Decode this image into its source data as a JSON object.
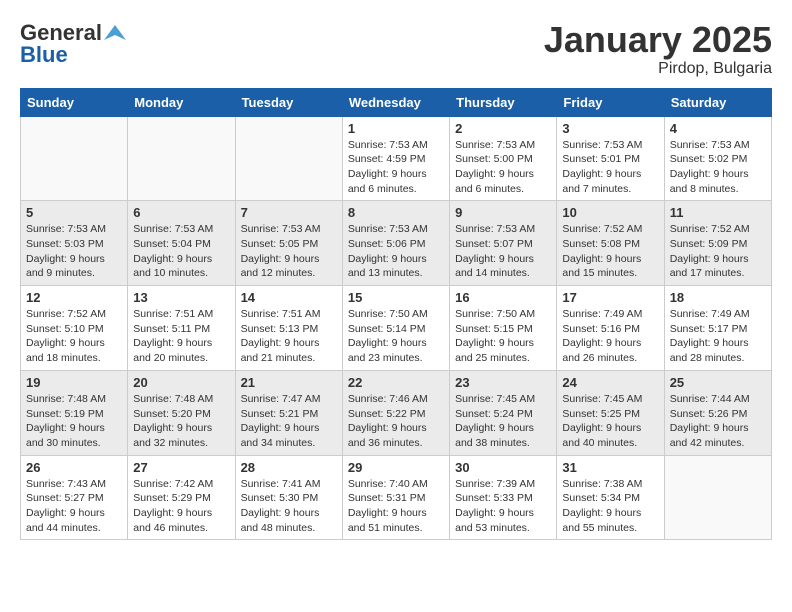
{
  "header": {
    "logo_general": "General",
    "logo_blue": "Blue",
    "title": "January 2025",
    "subtitle": "Pirdop, Bulgaria"
  },
  "days_header": [
    "Sunday",
    "Monday",
    "Tuesday",
    "Wednesday",
    "Thursday",
    "Friday",
    "Saturday"
  ],
  "weeks": [
    {
      "shaded": false,
      "days": [
        {
          "num": "",
          "info": "",
          "empty": true
        },
        {
          "num": "",
          "info": "",
          "empty": true
        },
        {
          "num": "",
          "info": "",
          "empty": true
        },
        {
          "num": "1",
          "info": "Sunrise: 7:53 AM\nSunset: 4:59 PM\nDaylight: 9 hours\nand 6 minutes.",
          "empty": false
        },
        {
          "num": "2",
          "info": "Sunrise: 7:53 AM\nSunset: 5:00 PM\nDaylight: 9 hours\nand 6 minutes.",
          "empty": false
        },
        {
          "num": "3",
          "info": "Sunrise: 7:53 AM\nSunset: 5:01 PM\nDaylight: 9 hours\nand 7 minutes.",
          "empty": false
        },
        {
          "num": "4",
          "info": "Sunrise: 7:53 AM\nSunset: 5:02 PM\nDaylight: 9 hours\nand 8 minutes.",
          "empty": false
        }
      ]
    },
    {
      "shaded": true,
      "days": [
        {
          "num": "5",
          "info": "Sunrise: 7:53 AM\nSunset: 5:03 PM\nDaylight: 9 hours\nand 9 minutes.",
          "empty": false
        },
        {
          "num": "6",
          "info": "Sunrise: 7:53 AM\nSunset: 5:04 PM\nDaylight: 9 hours\nand 10 minutes.",
          "empty": false
        },
        {
          "num": "7",
          "info": "Sunrise: 7:53 AM\nSunset: 5:05 PM\nDaylight: 9 hours\nand 12 minutes.",
          "empty": false
        },
        {
          "num": "8",
          "info": "Sunrise: 7:53 AM\nSunset: 5:06 PM\nDaylight: 9 hours\nand 13 minutes.",
          "empty": false
        },
        {
          "num": "9",
          "info": "Sunrise: 7:53 AM\nSunset: 5:07 PM\nDaylight: 9 hours\nand 14 minutes.",
          "empty": false
        },
        {
          "num": "10",
          "info": "Sunrise: 7:52 AM\nSunset: 5:08 PM\nDaylight: 9 hours\nand 15 minutes.",
          "empty": false
        },
        {
          "num": "11",
          "info": "Sunrise: 7:52 AM\nSunset: 5:09 PM\nDaylight: 9 hours\nand 17 minutes.",
          "empty": false
        }
      ]
    },
    {
      "shaded": false,
      "days": [
        {
          "num": "12",
          "info": "Sunrise: 7:52 AM\nSunset: 5:10 PM\nDaylight: 9 hours\nand 18 minutes.",
          "empty": false
        },
        {
          "num": "13",
          "info": "Sunrise: 7:51 AM\nSunset: 5:11 PM\nDaylight: 9 hours\nand 20 minutes.",
          "empty": false
        },
        {
          "num": "14",
          "info": "Sunrise: 7:51 AM\nSunset: 5:13 PM\nDaylight: 9 hours\nand 21 minutes.",
          "empty": false
        },
        {
          "num": "15",
          "info": "Sunrise: 7:50 AM\nSunset: 5:14 PM\nDaylight: 9 hours\nand 23 minutes.",
          "empty": false
        },
        {
          "num": "16",
          "info": "Sunrise: 7:50 AM\nSunset: 5:15 PM\nDaylight: 9 hours\nand 25 minutes.",
          "empty": false
        },
        {
          "num": "17",
          "info": "Sunrise: 7:49 AM\nSunset: 5:16 PM\nDaylight: 9 hours\nand 26 minutes.",
          "empty": false
        },
        {
          "num": "18",
          "info": "Sunrise: 7:49 AM\nSunset: 5:17 PM\nDaylight: 9 hours\nand 28 minutes.",
          "empty": false
        }
      ]
    },
    {
      "shaded": true,
      "days": [
        {
          "num": "19",
          "info": "Sunrise: 7:48 AM\nSunset: 5:19 PM\nDaylight: 9 hours\nand 30 minutes.",
          "empty": false
        },
        {
          "num": "20",
          "info": "Sunrise: 7:48 AM\nSunset: 5:20 PM\nDaylight: 9 hours\nand 32 minutes.",
          "empty": false
        },
        {
          "num": "21",
          "info": "Sunrise: 7:47 AM\nSunset: 5:21 PM\nDaylight: 9 hours\nand 34 minutes.",
          "empty": false
        },
        {
          "num": "22",
          "info": "Sunrise: 7:46 AM\nSunset: 5:22 PM\nDaylight: 9 hours\nand 36 minutes.",
          "empty": false
        },
        {
          "num": "23",
          "info": "Sunrise: 7:45 AM\nSunset: 5:24 PM\nDaylight: 9 hours\nand 38 minutes.",
          "empty": false
        },
        {
          "num": "24",
          "info": "Sunrise: 7:45 AM\nSunset: 5:25 PM\nDaylight: 9 hours\nand 40 minutes.",
          "empty": false
        },
        {
          "num": "25",
          "info": "Sunrise: 7:44 AM\nSunset: 5:26 PM\nDaylight: 9 hours\nand 42 minutes.",
          "empty": false
        }
      ]
    },
    {
      "shaded": false,
      "days": [
        {
          "num": "26",
          "info": "Sunrise: 7:43 AM\nSunset: 5:27 PM\nDaylight: 9 hours\nand 44 minutes.",
          "empty": false
        },
        {
          "num": "27",
          "info": "Sunrise: 7:42 AM\nSunset: 5:29 PM\nDaylight: 9 hours\nand 46 minutes.",
          "empty": false
        },
        {
          "num": "28",
          "info": "Sunrise: 7:41 AM\nSunset: 5:30 PM\nDaylight: 9 hours\nand 48 minutes.",
          "empty": false
        },
        {
          "num": "29",
          "info": "Sunrise: 7:40 AM\nSunset: 5:31 PM\nDaylight: 9 hours\nand 51 minutes.",
          "empty": false
        },
        {
          "num": "30",
          "info": "Sunrise: 7:39 AM\nSunset: 5:33 PM\nDaylight: 9 hours\nand 53 minutes.",
          "empty": false
        },
        {
          "num": "31",
          "info": "Sunrise: 7:38 AM\nSunset: 5:34 PM\nDaylight: 9 hours\nand 55 minutes.",
          "empty": false
        },
        {
          "num": "",
          "info": "",
          "empty": true
        }
      ]
    }
  ]
}
